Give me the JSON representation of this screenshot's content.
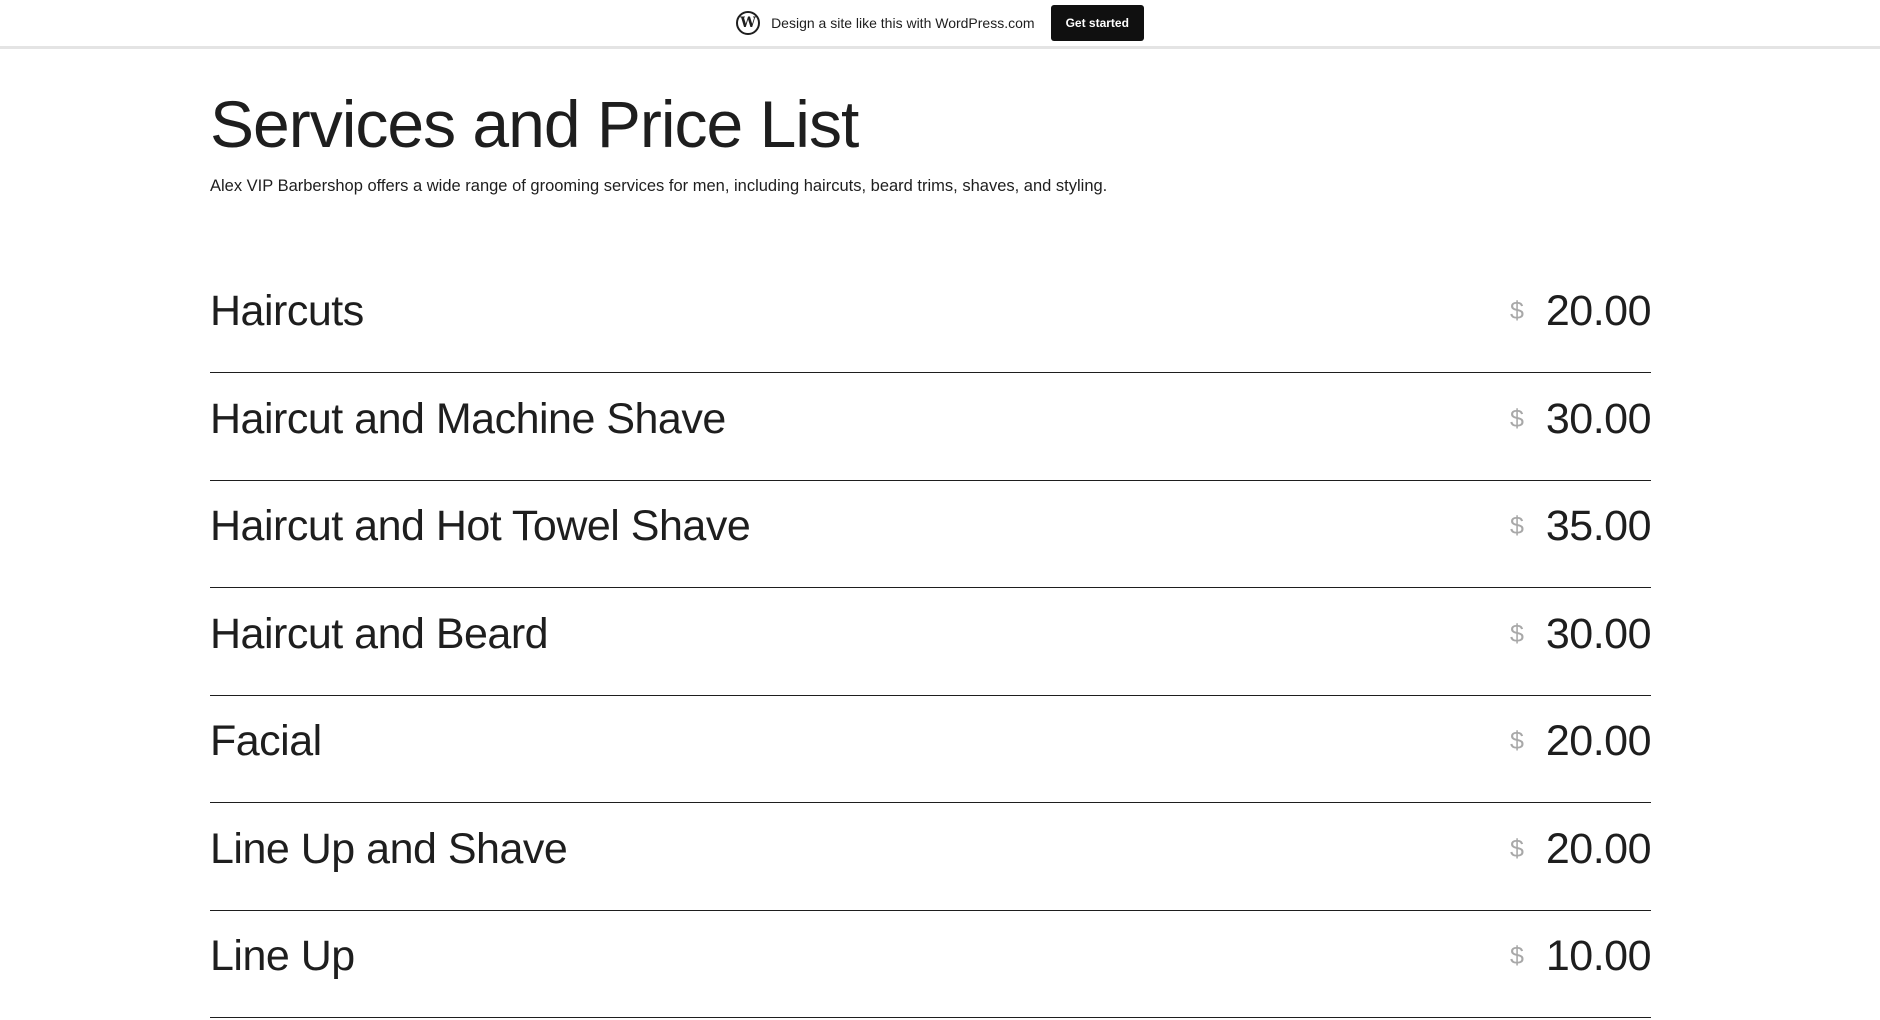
{
  "banner": {
    "logo_glyph": "W",
    "text": "Design a site like this with WordPress.com",
    "button_label": "Get started"
  },
  "page": {
    "title": "Services and Price List",
    "intro": "Alex VIP Barbershop offers a wide range of grooming services for men, including haircuts, beard trims, shaves, and styling."
  },
  "services": [
    {
      "name": "Haircuts",
      "currency": "$",
      "price": "20.00"
    },
    {
      "name": "Haircut and Machine Shave",
      "currency": "$",
      "price": "30.00"
    },
    {
      "name": "Haircut and Hot Towel Shave",
      "currency": "$",
      "price": "35.00"
    },
    {
      "name": "Haircut and Beard",
      "currency": "$",
      "price": "30.00"
    },
    {
      "name": "Facial",
      "currency": "$",
      "price": "20.00"
    },
    {
      "name": "Line Up and Shave",
      "currency": "$",
      "price": "20.00"
    },
    {
      "name": "Line Up",
      "currency": "$",
      "price": "10.00"
    }
  ],
  "colors": {
    "text": "#1e1e1e",
    "currency": "#a8a8a8",
    "button_bg": "#101010"
  }
}
